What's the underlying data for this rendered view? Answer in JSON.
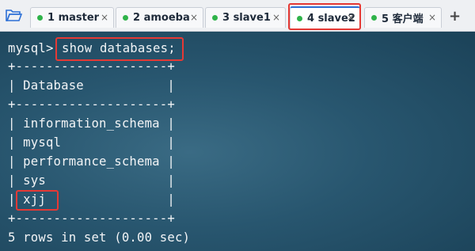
{
  "tabs": [
    {
      "label": "1 master"
    },
    {
      "label": "2 amoeba"
    },
    {
      "label": "3 slave1"
    },
    {
      "label": "4 slave2"
    },
    {
      "label": "5 客户端"
    }
  ],
  "tab_close_glyph": "×",
  "add_tab_glyph": "+",
  "terminal": {
    "prompt": "mysql>",
    "command": "show databases;",
    "border_line": "+--------------------+",
    "header_row": "| Database           |",
    "rows": [
      "| information_schema |",
      "| mysql              |",
      "| performance_schema |",
      "| sys                |",
      "| xjj                |"
    ],
    "result_summary": "5 rows in set (0.00 sec)"
  },
  "colors": {
    "status_dot": "#2fb34a",
    "highlight": "#e53935",
    "active_tab_accent": "#2b6fd6"
  }
}
